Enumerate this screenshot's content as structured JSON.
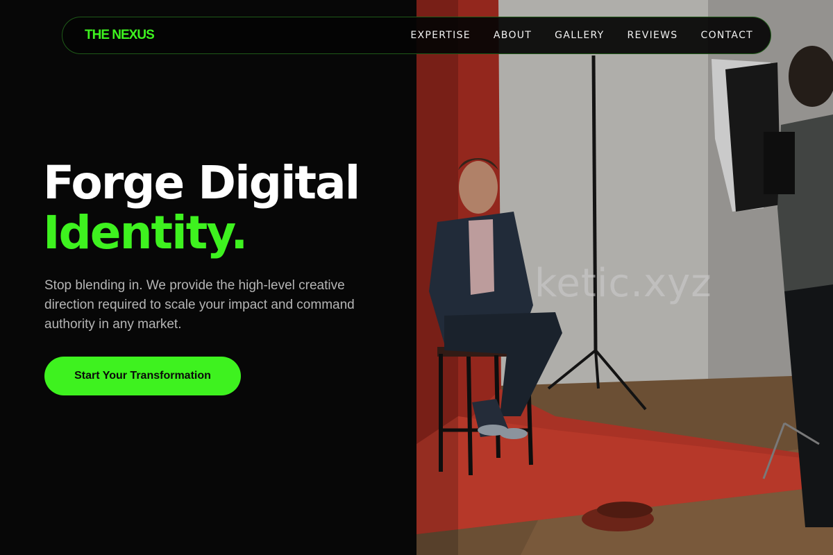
{
  "brand": {
    "logo": "THE NEXUS"
  },
  "nav": {
    "items": [
      {
        "label": "EXPERTISE"
      },
      {
        "label": "ABOUT"
      },
      {
        "label": "GALLERY"
      },
      {
        "label": "REVIEWS"
      },
      {
        "label": "CONTACT"
      }
    ]
  },
  "hero": {
    "title_line1": "Forge Digital",
    "title_line2": "Identity.",
    "subtitle": "Stop blending in. We provide the high-level creative direction required to scale your impact and command authority in any market.",
    "cta_label": "Start Your Transformation"
  },
  "photo": {
    "watermark": "ketic.xyz"
  },
  "colors": {
    "accent": "#3ef21f",
    "background": "#070707",
    "text": "#ffffff",
    "muted": "#b5b5b5"
  }
}
